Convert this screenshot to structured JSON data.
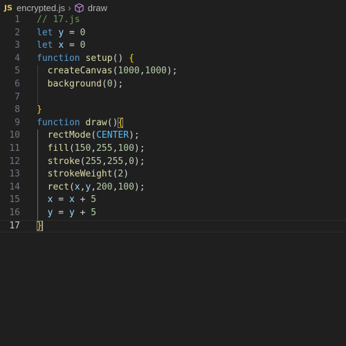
{
  "breadcrumb": {
    "lang_badge": "JS",
    "file": "encrypted.js",
    "separator": "›",
    "symbol": "draw",
    "symbol_icon": "cube-icon"
  },
  "editor": {
    "current_line": 17,
    "lines": [
      {
        "n": "1",
        "tokens": [
          {
            "t": "// 17.js",
            "c": "cmt"
          }
        ]
      },
      {
        "n": "2",
        "tokens": [
          {
            "t": "let",
            "c": "kw"
          },
          {
            "t": " ",
            "c": "pun"
          },
          {
            "t": "y",
            "c": "var"
          },
          {
            "t": " = ",
            "c": "pun"
          },
          {
            "t": "0",
            "c": "num"
          }
        ]
      },
      {
        "n": "3",
        "tokens": [
          {
            "t": "let",
            "c": "kw"
          },
          {
            "t": " ",
            "c": "pun"
          },
          {
            "t": "x",
            "c": "var"
          },
          {
            "t": " = ",
            "c": "pun"
          },
          {
            "t": "0",
            "c": "num"
          }
        ]
      },
      {
        "n": "4",
        "tokens": [
          {
            "t": "function",
            "c": "kw"
          },
          {
            "t": " ",
            "c": "pun"
          },
          {
            "t": "setup",
            "c": "fn"
          },
          {
            "t": "() ",
            "c": "pun"
          },
          {
            "t": "{",
            "c": "brk"
          }
        ]
      },
      {
        "n": "5",
        "tokens": [
          {
            "t": "  ",
            "c": "pun"
          },
          {
            "t": "createCanvas",
            "c": "fn"
          },
          {
            "t": "(",
            "c": "pun"
          },
          {
            "t": "1000",
            "c": "num"
          },
          {
            "t": ",",
            "c": "pun"
          },
          {
            "t": "1000",
            "c": "num"
          },
          {
            "t": ");",
            "c": "pun"
          }
        ]
      },
      {
        "n": "6",
        "tokens": [
          {
            "t": "  ",
            "c": "pun"
          },
          {
            "t": "background",
            "c": "fn"
          },
          {
            "t": "(",
            "c": "pun"
          },
          {
            "t": "0",
            "c": "num"
          },
          {
            "t": ");",
            "c": "pun"
          }
        ]
      },
      {
        "n": "7",
        "tokens": []
      },
      {
        "n": "8",
        "tokens": [
          {
            "t": "}",
            "c": "brk"
          }
        ]
      },
      {
        "n": "9",
        "tokens": [
          {
            "t": "function",
            "c": "kw"
          },
          {
            "t": " ",
            "c": "pun"
          },
          {
            "t": "draw",
            "c": "fn"
          },
          {
            "t": "()",
            "c": "pun"
          },
          {
            "t": "{",
            "c": "brk"
          }
        ]
      },
      {
        "n": "10",
        "tokens": [
          {
            "t": "  ",
            "c": "pun"
          },
          {
            "t": "rectMode",
            "c": "fn"
          },
          {
            "t": "(",
            "c": "pun"
          },
          {
            "t": "CENTER",
            "c": "con"
          },
          {
            "t": ");",
            "c": "pun"
          }
        ]
      },
      {
        "n": "11",
        "tokens": [
          {
            "t": "  ",
            "c": "pun"
          },
          {
            "t": "fill",
            "c": "fn"
          },
          {
            "t": "(",
            "c": "pun"
          },
          {
            "t": "150",
            "c": "num"
          },
          {
            "t": ",",
            "c": "pun"
          },
          {
            "t": "255",
            "c": "num"
          },
          {
            "t": ",",
            "c": "pun"
          },
          {
            "t": "100",
            "c": "num"
          },
          {
            "t": ");",
            "c": "pun"
          }
        ]
      },
      {
        "n": "12",
        "tokens": [
          {
            "t": "  ",
            "c": "pun"
          },
          {
            "t": "stroke",
            "c": "fn"
          },
          {
            "t": "(",
            "c": "pun"
          },
          {
            "t": "255",
            "c": "num"
          },
          {
            "t": ",",
            "c": "pun"
          },
          {
            "t": "255",
            "c": "num"
          },
          {
            "t": ",",
            "c": "pun"
          },
          {
            "t": "0",
            "c": "num"
          },
          {
            "t": ");",
            "c": "pun"
          }
        ]
      },
      {
        "n": "13",
        "tokens": [
          {
            "t": "  ",
            "c": "pun"
          },
          {
            "t": "strokeWeight",
            "c": "fn"
          },
          {
            "t": "(",
            "c": "pun"
          },
          {
            "t": "2",
            "c": "num"
          },
          {
            "t": ")",
            "c": "pun"
          }
        ]
      },
      {
        "n": "14",
        "tokens": [
          {
            "t": "  ",
            "c": "pun"
          },
          {
            "t": "rect",
            "c": "fn"
          },
          {
            "t": "(",
            "c": "pun"
          },
          {
            "t": "x",
            "c": "var"
          },
          {
            "t": ",",
            "c": "pun"
          },
          {
            "t": "y",
            "c": "var"
          },
          {
            "t": ",",
            "c": "pun"
          },
          {
            "t": "200",
            "c": "num"
          },
          {
            "t": ",",
            "c": "pun"
          },
          {
            "t": "100",
            "c": "num"
          },
          {
            "t": ");",
            "c": "pun"
          }
        ]
      },
      {
        "n": "15",
        "tokens": [
          {
            "t": "  ",
            "c": "pun"
          },
          {
            "t": "x",
            "c": "var"
          },
          {
            "t": " = ",
            "c": "pun"
          },
          {
            "t": "x",
            "c": "var"
          },
          {
            "t": " + ",
            "c": "pun"
          },
          {
            "t": "5",
            "c": "num"
          }
        ]
      },
      {
        "n": "16",
        "tokens": [
          {
            "t": "  ",
            "c": "pun"
          },
          {
            "t": "y",
            "c": "var"
          },
          {
            "t": " = ",
            "c": "pun"
          },
          {
            "t": "y",
            "c": "var"
          },
          {
            "t": " + ",
            "c": "pun"
          },
          {
            "t": "5",
            "c": "num"
          }
        ]
      },
      {
        "n": "17",
        "tokens": [
          {
            "t": "}",
            "c": "brk"
          }
        ]
      }
    ]
  },
  "colors": {
    "background": "#1f1f1f",
    "keyword": "#569cd6",
    "function": "#dcdcaa",
    "variable": "#9cdcfe",
    "number": "#b5cea8",
    "comment": "#6a9955",
    "constant": "#4fc1ff",
    "bracket": "#ffd700"
  }
}
